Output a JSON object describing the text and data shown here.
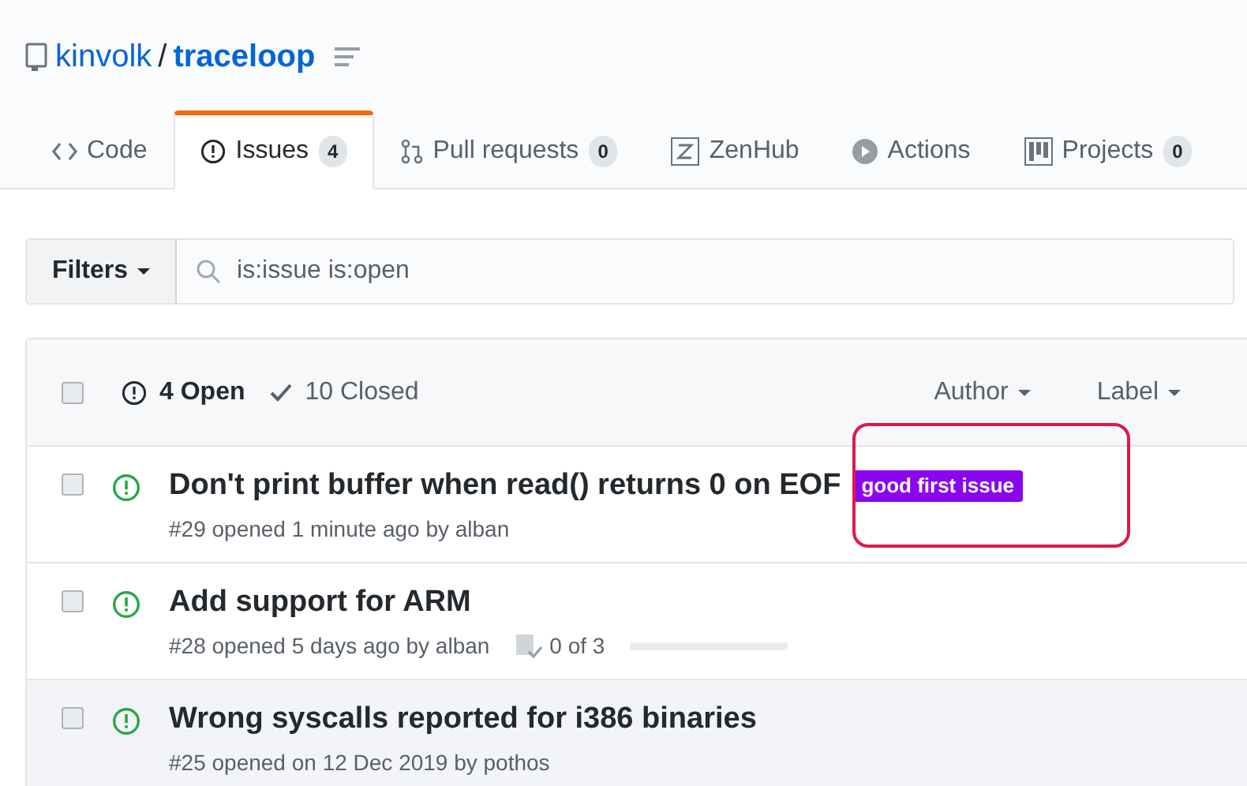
{
  "repo": {
    "owner": "kinvolk",
    "separator": "/",
    "name": "traceloop"
  },
  "tabs": [
    {
      "label": "Code",
      "selected": false
    },
    {
      "label": "Issues",
      "count": "4",
      "selected": true
    },
    {
      "label": "Pull requests",
      "count": "0",
      "selected": false
    },
    {
      "label": "ZenHub",
      "selected": false
    },
    {
      "label": "Actions",
      "selected": false
    },
    {
      "label": "Projects",
      "count": "0",
      "selected": false
    }
  ],
  "filters": {
    "button": "Filters",
    "query": "is:issue is:open"
  },
  "issue_list": {
    "header": {
      "checked": false,
      "open": "4 Open",
      "closed": "10 Closed",
      "menus": [
        "Author",
        "Label"
      ]
    },
    "issues": [
      {
        "title": "Don't print buffer when read() returns 0 on EOF",
        "checked": false,
        "highlighted": false,
        "labels": [
          {
            "text": "good first issue",
            "color": "#8a05f0"
          }
        ],
        "meta": "#29 opened 1 minute ago by alban"
      },
      {
        "title": "Add support for ARM",
        "checked": false,
        "highlighted": false,
        "meta": "#28 opened 5 days ago by alban",
        "tasks": {
          "text": "0 of 3",
          "level": 0
        }
      },
      {
        "title": "Wrong syscalls reported for i386 binaries",
        "checked": false,
        "highlighted": true,
        "meta": "#25 opened on 12 Dec 2019 by pothos"
      }
    ]
  },
  "annotation": {
    "kind": "highlight-frame",
    "color": "#e0184a"
  }
}
